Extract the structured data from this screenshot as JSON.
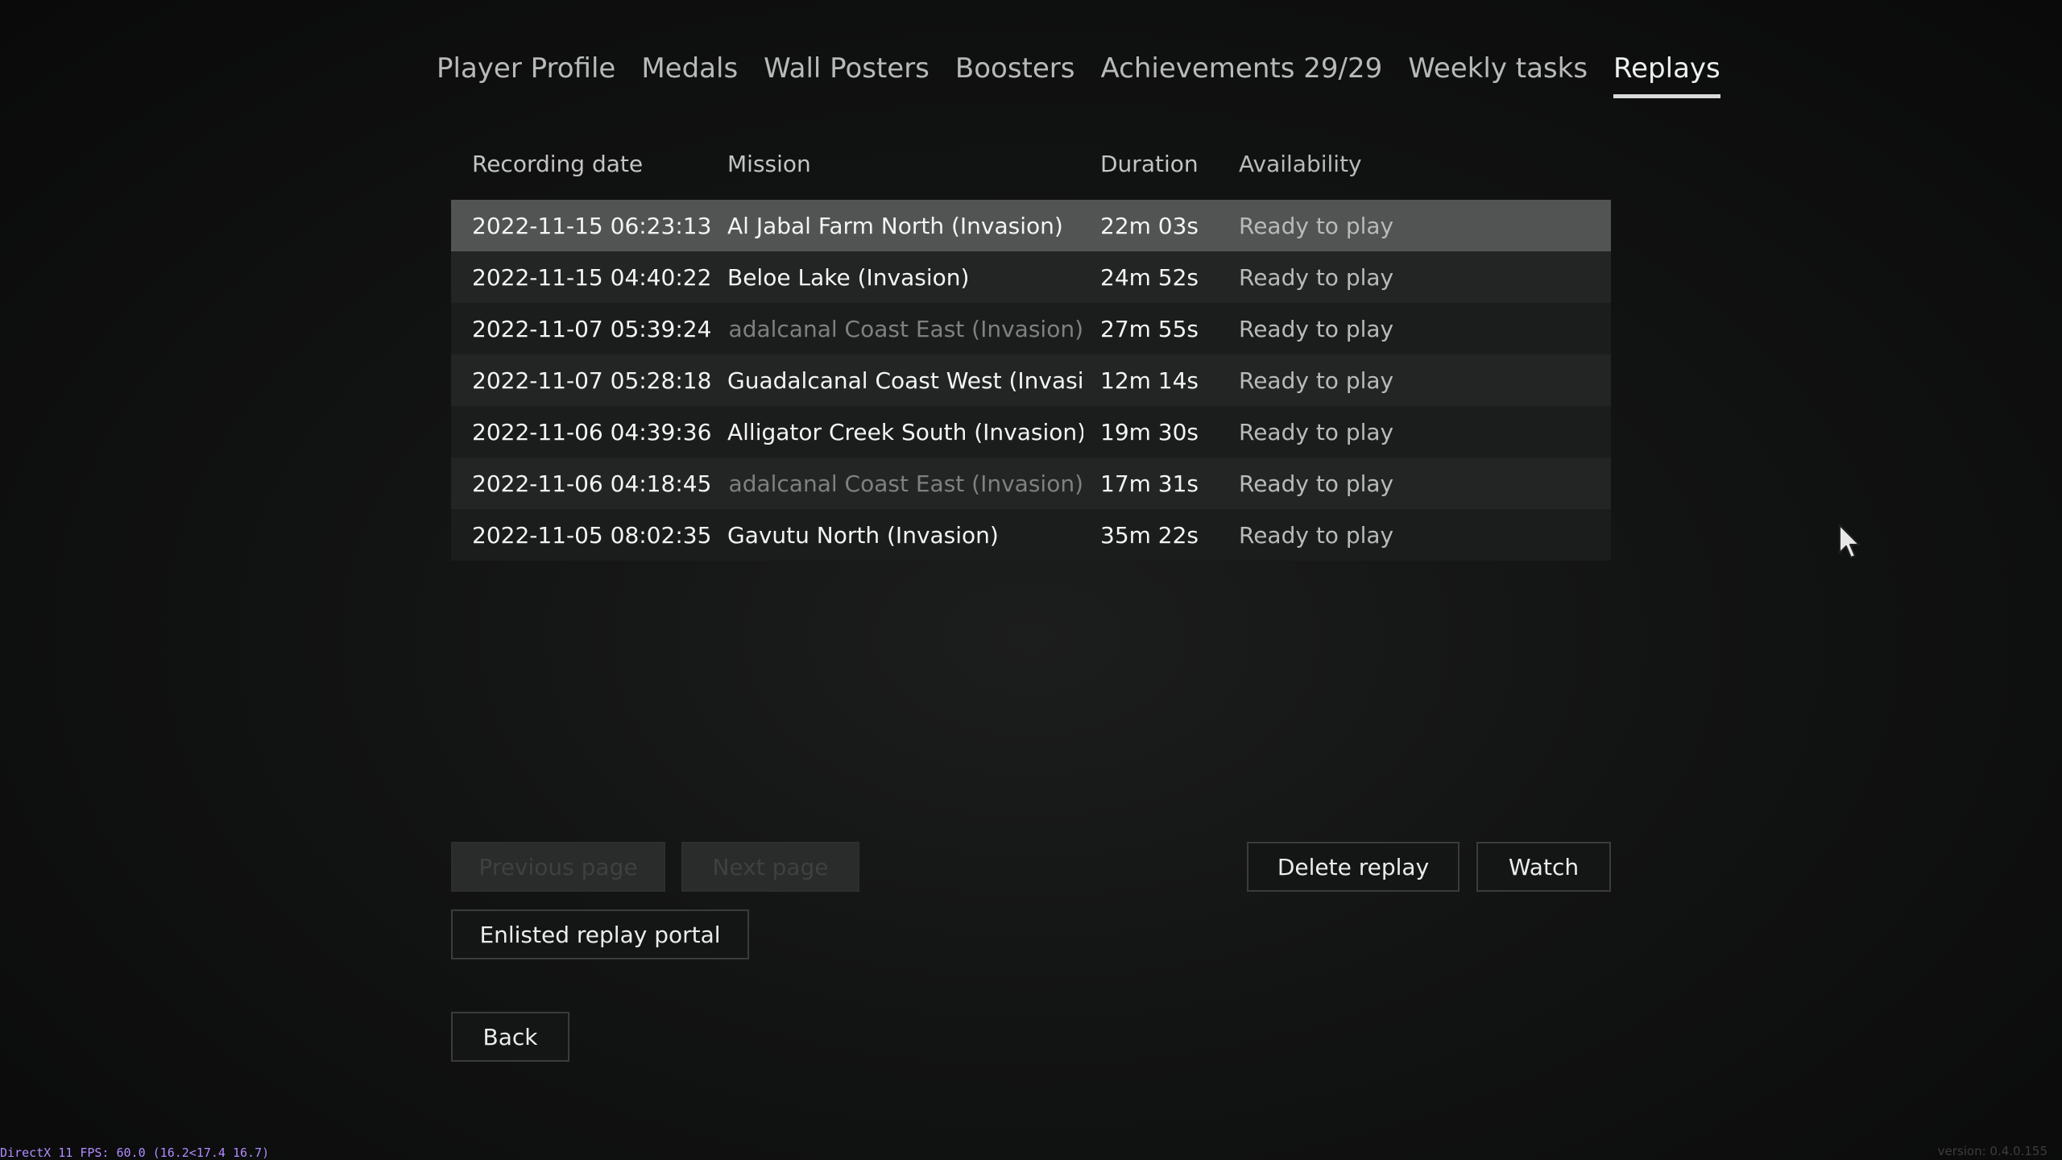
{
  "tabs": [
    {
      "label": "Player Profile"
    },
    {
      "label": "Medals"
    },
    {
      "label": "Wall Posters"
    },
    {
      "label": "Boosters"
    },
    {
      "label": "Achievements 29/29"
    },
    {
      "label": "Weekly tasks"
    },
    {
      "label": "Replays",
      "active": true
    }
  ],
  "table": {
    "headers": {
      "date": "Recording date",
      "mission": "Mission",
      "duration": "Duration",
      "availability": "Availability"
    },
    "rows": [
      {
        "date": "2022-11-15 06:23:13",
        "mission": "Al Jabal Farm North (Invasion)",
        "duration": "22m 03s",
        "availability": "Ready to play",
        "selected": true
      },
      {
        "date": "2022-11-15 04:40:22",
        "mission": "Beloe Lake (Invasion)",
        "duration": "24m 52s",
        "availability": "Ready to play"
      },
      {
        "date": "2022-11-07 05:39:24",
        "mission": "Guadalcanal Coast East (Invasion)",
        "duration": "27m 55s",
        "availability": "Ready to play",
        "dimmed": true
      },
      {
        "date": "2022-11-07 05:28:18",
        "mission": "Guadalcanal Coast West (Invasion)",
        "duration": "12m 14s",
        "availability": "Ready to play"
      },
      {
        "date": "2022-11-06 04:39:36",
        "mission": "Alligator Creek South (Invasion)",
        "duration": "19m 30s",
        "availability": "Ready to play"
      },
      {
        "date": "2022-11-06 04:18:45",
        "mission": "Guadalcanal Coast East (Invasion)",
        "duration": "17m 31s",
        "availability": "Ready to play",
        "dimmed": true
      },
      {
        "date": "2022-11-05 08:02:35",
        "mission": "Gavutu North (Invasion)",
        "duration": "35m 22s",
        "availability": "Ready to play"
      }
    ]
  },
  "buttons": {
    "previous_page": "Previous page",
    "next_page": "Next page",
    "delete_replay": "Delete replay",
    "watch": "Watch",
    "replay_portal": "Enlisted replay portal",
    "back": "Back"
  },
  "footer": {
    "fps": "DirectX 11 FPS: 60.0 (16.2<17.4 16.7)",
    "version": "version: 0.4.0.155"
  },
  "colors": {
    "selected_row": "#525353",
    "fps_text": "#b08cff"
  }
}
